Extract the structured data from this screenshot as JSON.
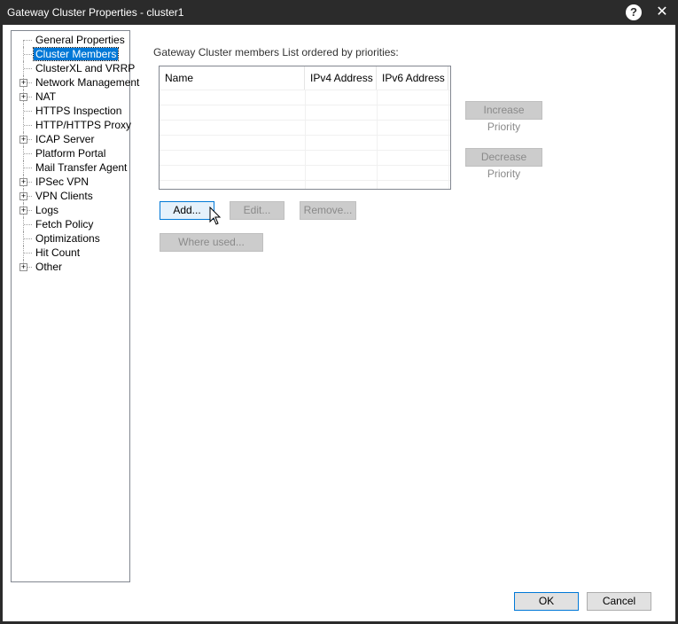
{
  "window": {
    "title": "Gateway Cluster Properties - cluster1",
    "help_label": "?",
    "close_label": "✕"
  },
  "tree": {
    "items": [
      {
        "label": "General Properties",
        "expandable": false,
        "selected": false
      },
      {
        "label": "Cluster Members",
        "expandable": false,
        "selected": true
      },
      {
        "label": "ClusterXL and VRRP",
        "expandable": false,
        "selected": false
      },
      {
        "label": "Network Management",
        "expandable": true,
        "selected": false
      },
      {
        "label": "NAT",
        "expandable": true,
        "selected": false
      },
      {
        "label": "HTTPS Inspection",
        "expandable": false,
        "selected": false
      },
      {
        "label": "HTTP/HTTPS Proxy",
        "expandable": false,
        "selected": false
      },
      {
        "label": "ICAP Server",
        "expandable": true,
        "selected": false
      },
      {
        "label": "Platform Portal",
        "expandable": false,
        "selected": false
      },
      {
        "label": "Mail Transfer Agent",
        "expandable": false,
        "selected": false
      },
      {
        "label": "IPSec VPN",
        "expandable": true,
        "selected": false
      },
      {
        "label": "VPN Clients",
        "expandable": true,
        "selected": false
      },
      {
        "label": "Logs",
        "expandable": true,
        "selected": false
      },
      {
        "label": "Fetch Policy",
        "expandable": false,
        "selected": false
      },
      {
        "label": "Optimizations",
        "expandable": false,
        "selected": false
      },
      {
        "label": "Hit Count",
        "expandable": false,
        "selected": false
      },
      {
        "label": "Other",
        "expandable": true,
        "selected": false
      }
    ],
    "expander_symbol": "+"
  },
  "members": {
    "caption": "Gateway Cluster members List ordered by priorities:",
    "columns": [
      "Name",
      "IPv4 Address",
      "IPv6 Address"
    ],
    "rows": []
  },
  "buttons": {
    "increase_priority": "Increase Priority",
    "decrease_priority": "Decrease Priority",
    "add": "Add...",
    "edit": "Edit...",
    "remove": "Remove...",
    "where_used": "Where used...",
    "ok": "OK",
    "cancel": "Cancel"
  },
  "colors": {
    "title_bar": "#2b2b2b",
    "selection": "#0078d7"
  }
}
